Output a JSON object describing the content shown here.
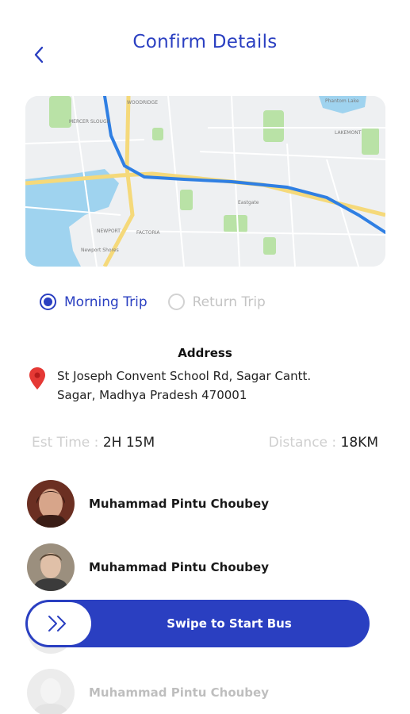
{
  "header": {
    "title": "Confirm Details",
    "back_icon": "chevron-left-icon"
  },
  "map": {
    "labels": {
      "mercer_slough": "MERCER SLOUGH",
      "woodridge": "WOODRIDGE",
      "eastgate": "Eastgate",
      "newport": "NEWPORT",
      "factoria": "FACTORIA",
      "newport_shores": "Newport Shores",
      "phantom_lake": "Phantom Lake",
      "lakemont": "LAKEMONT"
    },
    "route_color": "#2f7fe3"
  },
  "trip_options": [
    {
      "label": "Morning Trip",
      "selected": true
    },
    {
      "label": "Return Trip",
      "selected": false
    }
  ],
  "address": {
    "title": "Address",
    "line1": "St Joseph Convent School Rd, Sagar Cantt.",
    "line2": "Sagar, Madhya Pradesh 470001"
  },
  "stats": {
    "time_label": "Est Time : ",
    "time_value": "2H 15M",
    "distance_label": "Distance : ",
    "distance_value": "18KM"
  },
  "passengers": [
    {
      "name": "Muhammad Pintu Choubey"
    },
    {
      "name": "Muhammad Pintu Choubey"
    },
    {
      "name": "Muhammad Pintu Choubey"
    }
  ],
  "swipe": {
    "label": "Swipe to Start Bus",
    "icon": "double-chevron-right-icon"
  },
  "colors": {
    "primary": "#2a3fc1",
    "pin": "#e53935",
    "muted": "#cfcfcf"
  }
}
